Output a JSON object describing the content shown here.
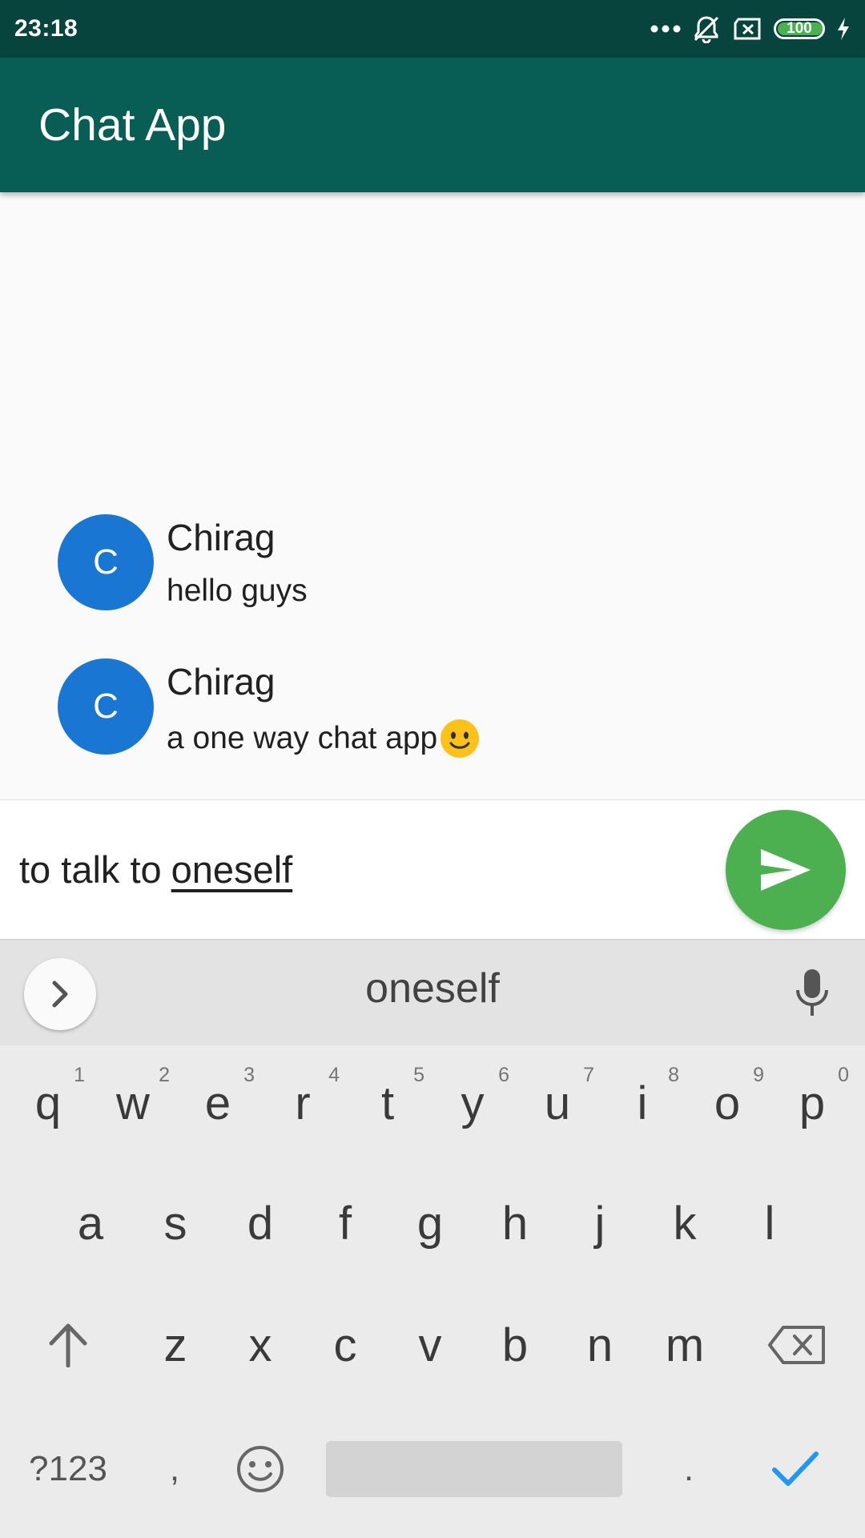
{
  "status_bar": {
    "time": "23:18",
    "battery": "100",
    "icons": [
      "more-dots-icon",
      "muted-bell-icon",
      "sim-x-icon",
      "battery-icon",
      "charging-bolt-icon"
    ]
  },
  "app_bar": {
    "title": "Chat App"
  },
  "messages": [
    {
      "avatar": "C",
      "name": "Chirag",
      "text": "hello guys"
    },
    {
      "avatar": "C",
      "name": "Chirag",
      "text": "a one way chat app",
      "emoji": "slightly-smiling-face-icon"
    }
  ],
  "input": {
    "text_plain": "to talk to",
    "text_underlined": "oneself"
  },
  "keyboard": {
    "suggestion": "oneself",
    "row1": [
      "q",
      "w",
      "e",
      "r",
      "t",
      "y",
      "u",
      "i",
      "o",
      "p"
    ],
    "row1_hints": [
      "1",
      "2",
      "3",
      "4",
      "5",
      "6",
      "7",
      "8",
      "9",
      "0"
    ],
    "row2": [
      "a",
      "s",
      "d",
      "f",
      "g",
      "h",
      "j",
      "k",
      "l"
    ],
    "row3": [
      "z",
      "x",
      "c",
      "v",
      "b",
      "n",
      "m"
    ],
    "symbols_key": "?123",
    "comma_key": ",",
    "period_key": "."
  },
  "colors": {
    "status_bar": "#06443d",
    "app_bar": "#085e54",
    "avatar": "#1976d2",
    "send_button": "#4caf50",
    "done_check": "#2196f3"
  }
}
